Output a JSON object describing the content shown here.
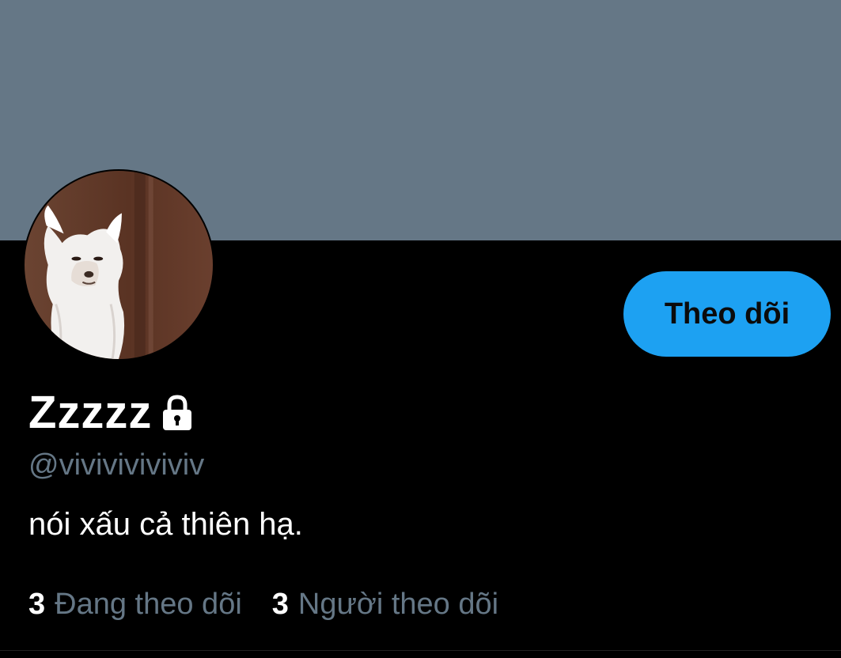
{
  "colors": {
    "banner": "#657786",
    "background": "#000000",
    "accent": "#1da1f2",
    "secondary_text": "#657786",
    "primary_text": "#ffffff"
  },
  "profile": {
    "display_name": "Zzzzz",
    "protected_icon": "lock-icon",
    "handle": "@viviviviviviv",
    "bio": "nói xấu cả thiên hạ.",
    "avatar_icon": "dog-avatar"
  },
  "actions": {
    "follow_label": "Theo dõi"
  },
  "stats": {
    "following_count": "3",
    "following_label": "Đang theo dõi",
    "followers_count": "3",
    "followers_label": "Người theo dõi"
  }
}
